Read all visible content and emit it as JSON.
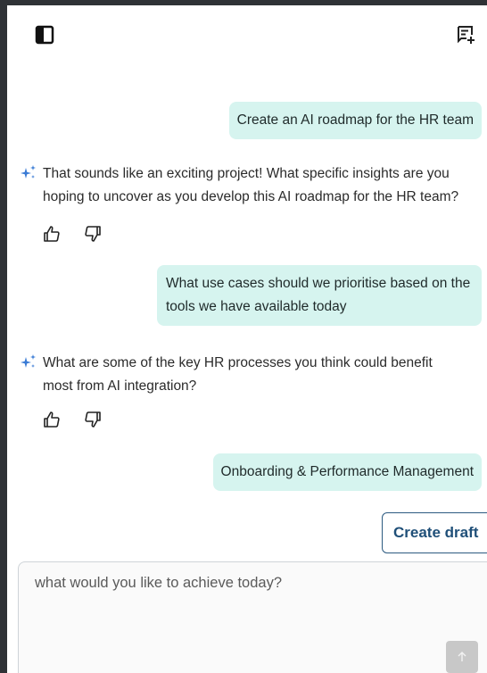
{
  "header": {
    "sidebar_toggle_icon": "sidebar-toggle-icon",
    "new_chat_icon": "new-chat-icon"
  },
  "messages": [
    {
      "role": "user",
      "text": "Create an AI roadmap for the HR team"
    },
    {
      "role": "assistant",
      "text": "That sounds like an exciting project! What specific insights are you hoping to uncover as you develop this AI roadmap for the HR team?"
    },
    {
      "role": "user",
      "text": "What use cases should we prioritise based on the tools we have available today"
    },
    {
      "role": "assistant",
      "text": "What are some of the key HR processes you think could benefit most from AI integration?"
    },
    {
      "role": "user",
      "text": "Onboarding & Performance Management"
    }
  ],
  "actions": {
    "create_draft_label": "Create draft"
  },
  "composer": {
    "placeholder": "what would you like to achieve today?"
  },
  "colors": {
    "user_bubble": "#d6f4ef",
    "accent": "#1f4f78",
    "sparkle": "#3a7bd5",
    "frame": "#2f3236"
  }
}
